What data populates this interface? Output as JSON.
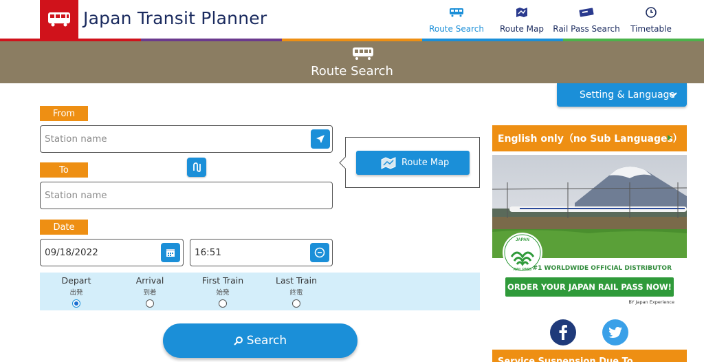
{
  "header": {
    "app_title": "Japan Transit Planner",
    "nav": [
      {
        "label": "Route Search",
        "icon": "train-icon",
        "active": true
      },
      {
        "label": "Route Map",
        "icon": "map-icon",
        "active": false
      },
      {
        "label": "Rail Pass Search",
        "icon": "ticket-icon",
        "active": false
      },
      {
        "label": "Timetable",
        "icon": "clock-icon",
        "active": false
      }
    ]
  },
  "colors": {
    "brand_red": "#d0121b",
    "accent_blue": "#1b8fd8",
    "banner_brown": "#8b7d62",
    "tag_orange": "#ee8f13",
    "strip": [
      "#d0121b",
      "#6b3a8e",
      "#ee8f13",
      "#1b8fd8",
      "#4bb34b"
    ]
  },
  "banner": {
    "title": "Route Search"
  },
  "settings": {
    "label": "Setting & Language"
  },
  "form": {
    "from_label": "From",
    "from_placeholder": "Station name",
    "to_label": "To",
    "to_placeholder": "Station name",
    "date_label": "Date",
    "date_value": "09/18/2022",
    "time_value": "16:51",
    "route_map_label": "Route Map",
    "options": [
      {
        "en": "Depart",
        "jp": "出発",
        "checked": true
      },
      {
        "en": "Arrival",
        "jp": "到着",
        "checked": false
      },
      {
        "en": "First Train",
        "jp": "始発",
        "checked": false
      },
      {
        "en": "Last Train",
        "jp": "終電",
        "checked": false
      }
    ],
    "search_label": "Search"
  },
  "sidebar": {
    "ad_heading": "English only（no Sub Languages）",
    "ad": {
      "badge_text": "JAPAN RAIL PASS",
      "distributor": "#1 WORLDWIDE OFFICIAL DISTRIBUTOR",
      "order_cta": "ORDER YOUR JAPAN RAIL PASS NOW!",
      "by_line": "BY Japan Experience"
    },
    "next_heading": "Service Suspension Due To"
  }
}
